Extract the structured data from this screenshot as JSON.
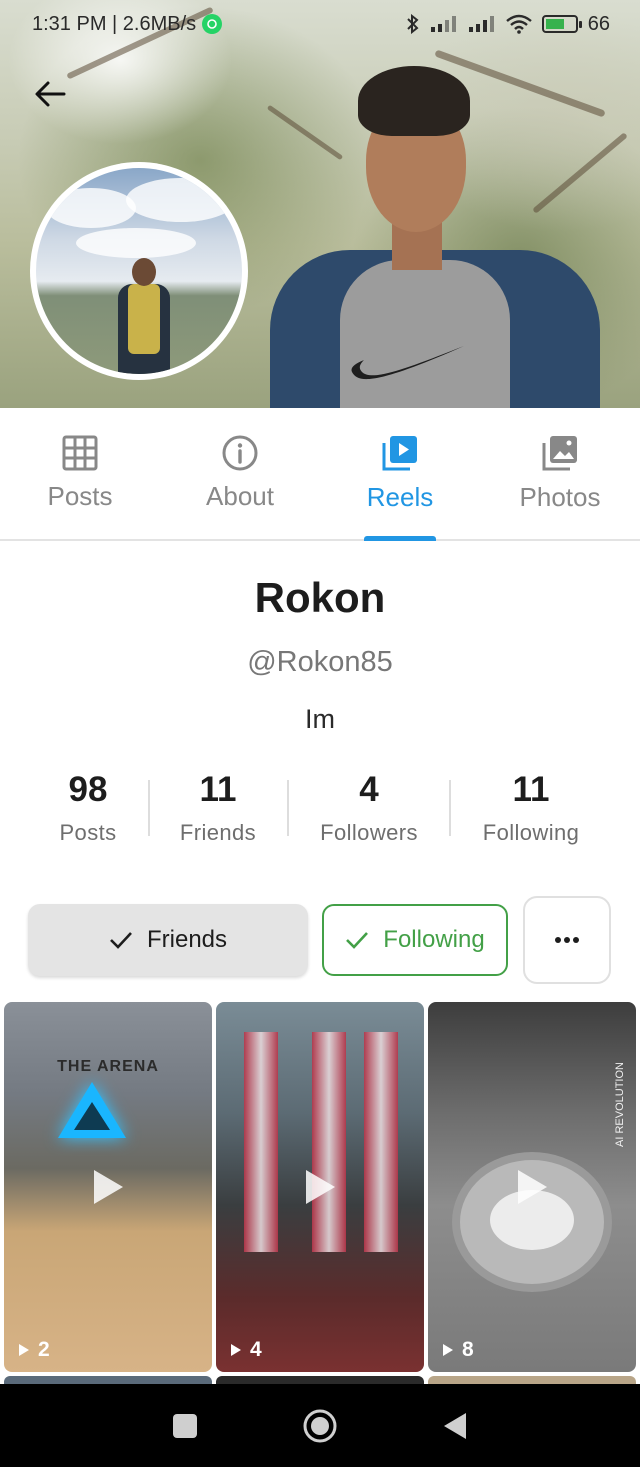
{
  "status_bar": {
    "time_speed": "1:31 PM | 2.6MB/s",
    "battery": "66",
    "battery_level": 0.66
  },
  "profile": {
    "name": "Rokon",
    "handle": "@Rokon85",
    "bio": "Im"
  },
  "tabs": [
    {
      "label": "Posts",
      "icon": "grid-icon",
      "active": false
    },
    {
      "label": "About",
      "icon": "info-icon",
      "active": false
    },
    {
      "label": "Reels",
      "icon": "reels-icon",
      "active": true
    },
    {
      "label": "Photos",
      "icon": "photos-icon",
      "active": false
    }
  ],
  "stats": [
    {
      "value": "98",
      "label": "Posts"
    },
    {
      "value": "11",
      "label": "Friends"
    },
    {
      "value": "4",
      "label": "Followers"
    },
    {
      "value": "11",
      "label": "Following"
    }
  ],
  "actions": {
    "friends_label": "Friends",
    "following_label": "Following",
    "more_icon": "more-horizontal-icon"
  },
  "reels": [
    {
      "count": "2",
      "overlay_text": "THE ARENA"
    },
    {
      "count": "4"
    },
    {
      "count": "8",
      "watermark": "AI REVOLUTION"
    }
  ],
  "colors": {
    "accent": "#2196e3",
    "following_green": "#43a047",
    "friends_bg": "#e4e4e4"
  }
}
